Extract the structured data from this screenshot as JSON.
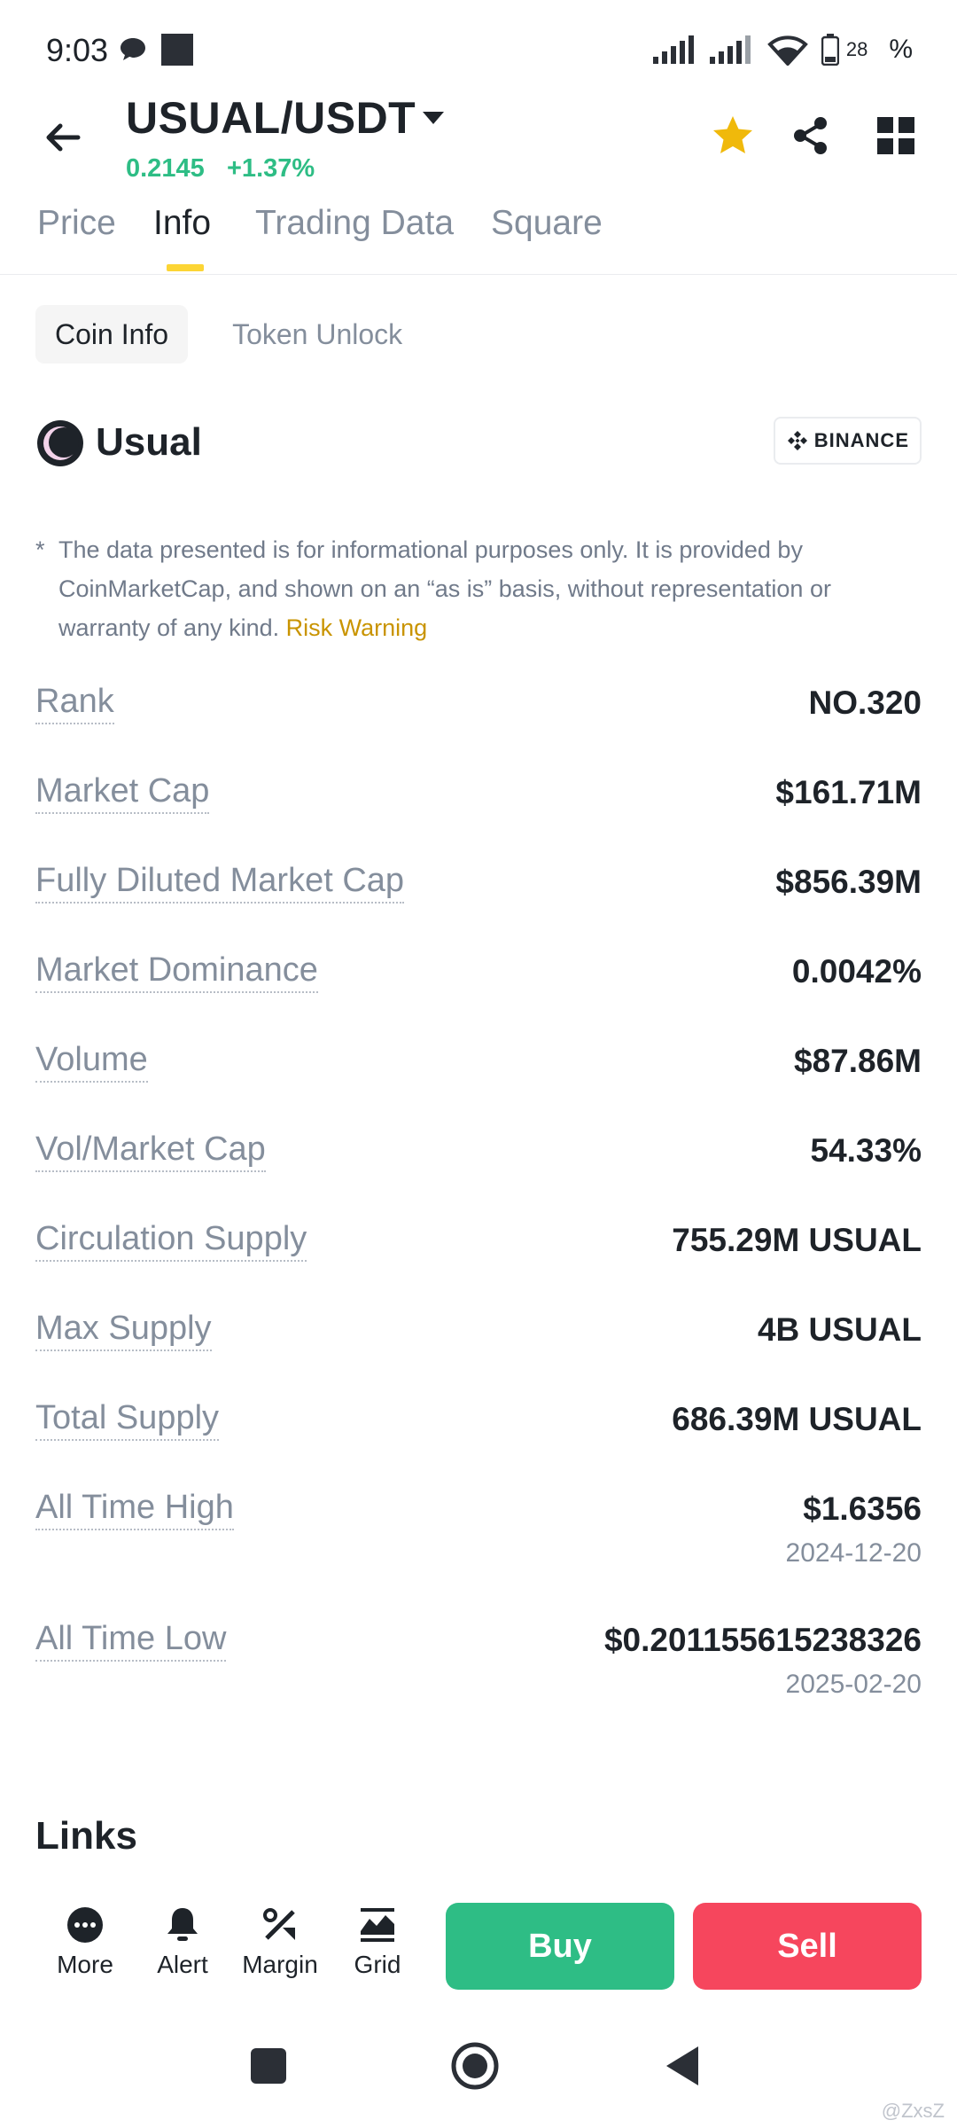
{
  "status_bar": {
    "time": "9:03",
    "battery": "28",
    "battery_suffix": "%"
  },
  "header": {
    "pair": "USUAL/USDT",
    "price": "0.2145",
    "change": "+1.37%"
  },
  "tabs": [
    {
      "label": "Price"
    },
    {
      "label": "Info"
    },
    {
      "label": "Trading Data"
    },
    {
      "label": "Square"
    }
  ],
  "subtabs": [
    {
      "label": "Coin Info"
    },
    {
      "label": "Token Unlock"
    }
  ],
  "coin": {
    "name": "Usual",
    "badge": "BINANCE"
  },
  "disclaimer": {
    "star": "*",
    "text": "The data presented is for informational purposes only. It is provided by CoinMarketCap, and shown on an “as is” basis, without representation or warranty of any kind.",
    "link": "Risk Warning"
  },
  "stats": [
    {
      "label": "Rank",
      "value": "NO.320"
    },
    {
      "label": "Market Cap",
      "value": "$161.71M"
    },
    {
      "label": "Fully Diluted Market Cap",
      "value": "$856.39M"
    },
    {
      "label": "Market Dominance",
      "value": "0.0042%"
    },
    {
      "label": "Volume",
      "value": "$87.86M"
    },
    {
      "label": "Vol/Market Cap",
      "value": "54.33%"
    },
    {
      "label": "Circulation Supply",
      "value": "755.29M USUAL"
    },
    {
      "label": "Max Supply",
      "value": "4B USUAL"
    },
    {
      "label": "Total Supply",
      "value": "686.39M USUAL"
    },
    {
      "label": "All Time High",
      "value": "$1.6356",
      "sub": "2024-12-20"
    },
    {
      "label": "All Time Low",
      "value": "$0.201155615238326",
      "sub": "2025-02-20"
    }
  ],
  "links_title": "Links",
  "actions": [
    {
      "label": "More",
      "icon": "more-icon"
    },
    {
      "label": "Alert",
      "icon": "bell-icon"
    },
    {
      "label": "Margin",
      "icon": "margin-icon"
    },
    {
      "label": "Grid",
      "icon": "grid-bot-icon"
    }
  ],
  "buttons": {
    "buy": "Buy",
    "sell": "Sell"
  },
  "watermark": "@ZxsZ",
  "colors": {
    "up": "#2ebd85",
    "down": "#f6465d",
    "accent": "#fcd535",
    "link": "#c99400"
  }
}
